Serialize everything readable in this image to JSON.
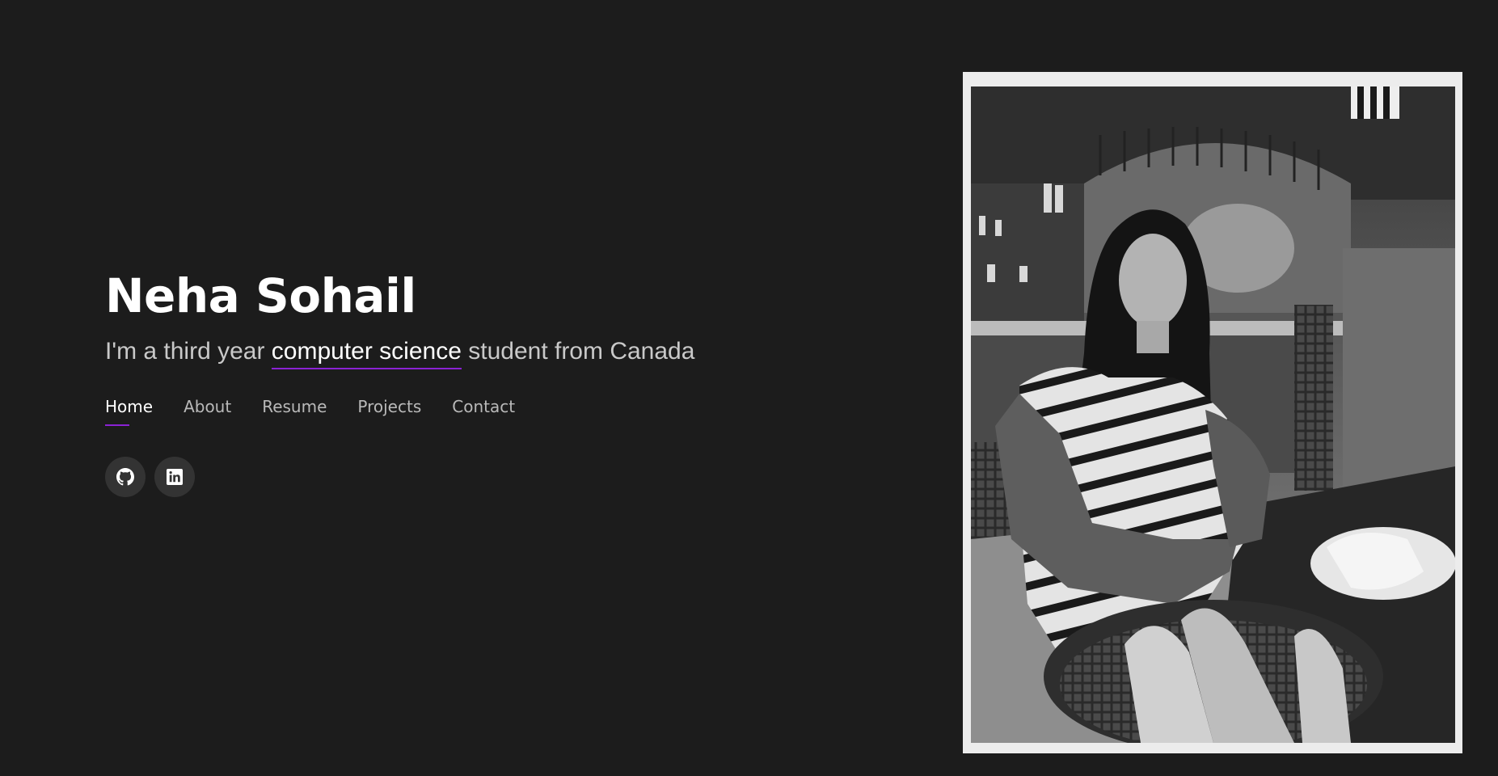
{
  "hero": {
    "name": "Neha Sohail",
    "tagline_before": "I'm a third year ",
    "tagline_highlight": "computer science",
    "tagline_after": " student from Canada"
  },
  "nav": {
    "items": [
      {
        "label": "Home",
        "active": true
      },
      {
        "label": "About",
        "active": false
      },
      {
        "label": "Resume",
        "active": false
      },
      {
        "label": "Projects",
        "active": false
      },
      {
        "label": "Contact",
        "active": false
      }
    ]
  },
  "socials": [
    {
      "icon": "github-icon"
    },
    {
      "icon": "linkedin-icon"
    }
  ],
  "colors": {
    "background": "#1c1c1c",
    "accent": "#8a22d4",
    "frame": "#ececec",
    "social_bg": "#333333"
  }
}
